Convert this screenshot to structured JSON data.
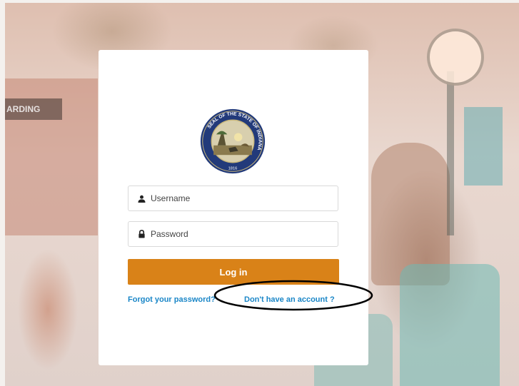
{
  "background": {
    "sign_text": "ARDING"
  },
  "login": {
    "seal_outer_text": "SEAL OF THE STATE OF INDIANA",
    "seal_year": "1816",
    "username": {
      "placeholder": "Username",
      "value": "",
      "icon": "user-icon"
    },
    "password": {
      "placeholder": "Password",
      "value": "",
      "icon": "lock-icon"
    },
    "login_button_label": "Log in",
    "forgot_password_label": "Forgot your password?",
    "no_account_label": "Don't have an account ?"
  },
  "colors": {
    "accent": "#d98218",
    "link": "#1a86c7",
    "seal_ring": "#223a7a"
  },
  "annotation": {
    "shape": "ellipse",
    "target": "no_account_label",
    "color": "#000000"
  }
}
